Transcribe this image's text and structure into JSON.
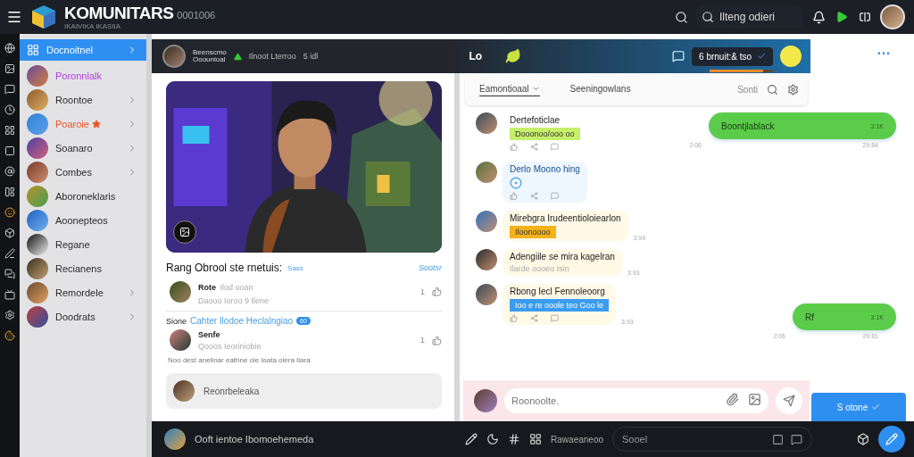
{
  "topbar": {
    "brand": "KOMUNITARS",
    "brand_code": "0001006",
    "tagline": "IKAIVIKA IKASIIA",
    "search": {
      "placeholder": "Ilteng odieri"
    }
  },
  "sidebar": {
    "items": [
      {
        "label": "Docnoitnel",
        "selected": true,
        "chevron": true,
        "starred": false,
        "color": "#ffffff"
      },
      {
        "label": "Poronnlalk",
        "selected": false,
        "chevron": false,
        "starred": false,
        "color": "#b53de0"
      },
      {
        "label": "Roontoe",
        "selected": false,
        "chevron": true,
        "starred": false,
        "color": "#2b2b2b"
      },
      {
        "label": "Poaroie",
        "selected": false,
        "chevron": true,
        "starred": true,
        "color": "#e8562a"
      },
      {
        "label": "Soanaro",
        "selected": false,
        "chevron": true,
        "starred": false,
        "color": "#2b2b2b"
      },
      {
        "label": "Combes",
        "selected": false,
        "chevron": true,
        "starred": false,
        "color": "#2b2b2b"
      },
      {
        "label": "Aboroneklaris",
        "selected": false,
        "chevron": false,
        "starred": false,
        "color": "#2b2b2b"
      },
      {
        "label": "Aoonepteos",
        "selected": false,
        "chevron": false,
        "starred": false,
        "color": "#2b2b2b"
      },
      {
        "label": "Regane",
        "selected": false,
        "chevron": false,
        "starred": false,
        "color": "#2b2b2b"
      },
      {
        "label": "Recianens",
        "selected": false,
        "chevron": false,
        "starred": false,
        "color": "#2b2b2b"
      },
      {
        "label": "Remordele",
        "selected": false,
        "chevron": true,
        "starred": false,
        "color": "#2b2b2b"
      },
      {
        "label": "Doodrats",
        "selected": false,
        "chevron": true,
        "starred": false,
        "color": "#2b2b2b"
      }
    ]
  },
  "header": {
    "title": "Beenscmo",
    "subtitle": "Ooounioal",
    "status": "Ilnoot Lterroo",
    "count": "5 idl",
    "center": "Lo",
    "pill": "6 brnuit:& tso",
    "progress": {
      "level": 0.85
    },
    "more": "…"
  },
  "post": {
    "title": "Rang Obrool ste rnetuis:",
    "tag": "Sass",
    "link": "Sootsr",
    "comments": [
      {
        "name": "Rote",
        "meta": "Ilod ooan",
        "text": "Daooo Ioroo 9 tlene",
        "count": "1"
      }
    ],
    "thread": {
      "prefix": "Sione",
      "title": "Cahter Ilodoe Heclalngiao",
      "badge": "60"
    },
    "thread_comments": [
      {
        "name": "Senfe",
        "text": "Qooos Ieoriniobie",
        "count": "1"
      }
    ],
    "note": "Noo dest anelinar eathne ole loata olera Ilara",
    "reply": "Reonrbeleaka"
  },
  "chat": {
    "filters": [
      {
        "label": "Eamontioaal",
        "selected": true
      },
      {
        "label": "Seeningowlans",
        "selected": false
      }
    ],
    "sort": "Sonti",
    "messages": [
      {
        "kind": "incoming",
        "name": "Dertefoticlae",
        "tag": "Dooonoo/ooo oo",
        "color": "#c6f06a",
        "actions": true
      },
      {
        "kind": "outgoing",
        "text": "Boontjlablack",
        "ticks": "3:1K",
        "time": "29:84",
        "side_time": "2:06"
      },
      {
        "kind": "incoming",
        "name": "Derlo Moono hing",
        "emoji": true,
        "actions": true
      },
      {
        "kind": "incoming",
        "name": "Mirebgra Irudeentioloiearlon",
        "tag": "Iloonoooo",
        "color": "#f6b21b",
        "actions": false,
        "time": "3:94"
      },
      {
        "kind": "incoming",
        "name": "Adengiile se mira kagelran",
        "sub": "Ilarde oooeo Isin",
        "actions": false,
        "time": "3:93"
      },
      {
        "kind": "incoming",
        "name": "Rbong Iecl Fennoleoorg",
        "tag": "Ioo e re ooole teo Goo le",
        "color": "#3a9cf0",
        "actions": true,
        "time": "3:93"
      },
      {
        "kind": "outgoing",
        "text": "Rf",
        "ticks": "3:1K",
        "time": "29:81",
        "side_time": "2:06"
      }
    ],
    "composer": {
      "placeholder": "Roonoolte."
    },
    "status_button": "S otone"
  },
  "bottombar": {
    "title": "Ooft ientoe Ibomoehemeda",
    "label": "Rawaeaneoo",
    "search": {
      "placeholder": "Sooel"
    }
  }
}
